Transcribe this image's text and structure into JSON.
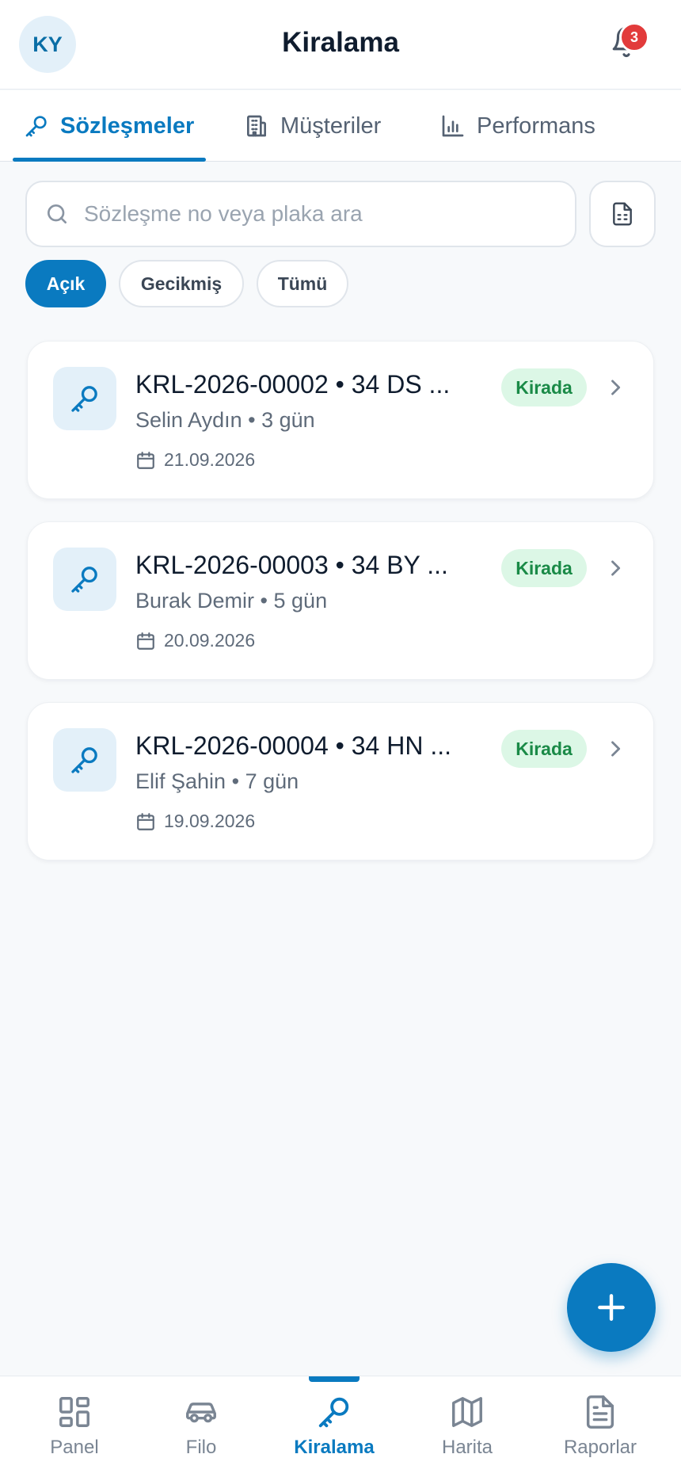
{
  "header": {
    "avatar_initials": "KY",
    "title": "Kiralama",
    "notification_count": "3"
  },
  "tabs": [
    {
      "label": "Sözleşmeler",
      "icon": "key-icon",
      "active": true
    },
    {
      "label": "Müşteriler",
      "icon": "building-icon",
      "active": false
    },
    {
      "label": "Performans",
      "icon": "bar-chart-icon",
      "active": false
    }
  ],
  "search": {
    "placeholder": "Sözleşme no veya plaka ara",
    "value": ""
  },
  "filters": [
    {
      "label": "Açık",
      "active": true
    },
    {
      "label": "Gecikmiş",
      "active": false
    },
    {
      "label": "Tümü",
      "active": false
    }
  ],
  "contracts": [
    {
      "title": "KRL-2026-00002 • 34 DS ...",
      "customer": "Selin Aydın",
      "duration": "3 gün",
      "date": "21.09.2026",
      "status": "Kirada"
    },
    {
      "title": "KRL-2026-00003 • 34 BY ...",
      "customer": "Burak Demir",
      "duration": "5 gün",
      "date": "20.09.2026",
      "status": "Kirada"
    },
    {
      "title": "KRL-2026-00004 • 34 HN ...",
      "customer": "Elif Şahin",
      "duration": "7 gün",
      "date": "19.09.2026",
      "status": "Kirada"
    }
  ],
  "bottom_nav": [
    {
      "label": "Panel",
      "icon": "grid-icon",
      "active": false
    },
    {
      "label": "Filo",
      "icon": "car-icon",
      "active": false
    },
    {
      "label": "Kiralama",
      "icon": "key-icon",
      "active": true
    },
    {
      "label": "Harita",
      "icon": "map-icon",
      "active": false
    },
    {
      "label": "Raporlar",
      "icon": "document-icon",
      "active": false
    }
  ],
  "colors": {
    "accent": "#0a7ac0",
    "badge_red": "#e23b3b",
    "status_green_bg": "#dcf7e6",
    "status_green_text": "#1a8a47"
  }
}
